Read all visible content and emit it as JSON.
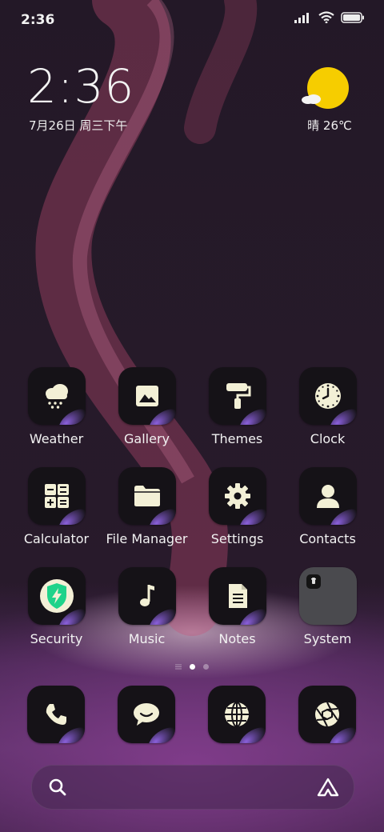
{
  "status_bar": {
    "time": "2:36",
    "icons": [
      "signal-icon",
      "wifi-icon",
      "battery-icon"
    ]
  },
  "clock_widget": {
    "time": "2:36",
    "date": "7月26日 周三下午"
  },
  "weather_widget": {
    "condition_icon": "sun-cloud-icon",
    "text": "晴 26℃",
    "sun_color": "#f6cd00"
  },
  "apps": [
    {
      "label": "Weather",
      "icon": "weather-snow-icon"
    },
    {
      "label": "Gallery",
      "icon": "image-icon"
    },
    {
      "label": "Themes",
      "icon": "paint-roller-icon"
    },
    {
      "label": "Clock",
      "icon": "clock-icon"
    },
    {
      "label": "Calculator",
      "icon": "calculator-icon"
    },
    {
      "label": "File Manager",
      "icon": "folder-icon"
    },
    {
      "label": "Settings",
      "icon": "gear-icon"
    },
    {
      "label": "Contacts",
      "icon": "person-icon"
    },
    {
      "label": "Security",
      "icon": "shield-bolt-icon"
    },
    {
      "label": "Music",
      "icon": "music-note-icon"
    },
    {
      "label": "Notes",
      "icon": "note-icon"
    },
    {
      "label": "System",
      "icon": "folder-group-icon"
    }
  ],
  "page_indicator": {
    "pages": 2,
    "current": 1
  },
  "dock": [
    {
      "icon": "phone-icon"
    },
    {
      "icon": "message-icon"
    },
    {
      "icon": "globe-icon"
    },
    {
      "icon": "camera-aperture-icon"
    }
  ],
  "search_bar": {
    "left_icon": "search-icon",
    "right_icon": "assistant-icon"
  },
  "colors": {
    "icon_glyph": "#f3f0d6",
    "tile_bg": "#151217",
    "security_green": "#1fd38a",
    "folder_bg": "#4a4a4e"
  }
}
